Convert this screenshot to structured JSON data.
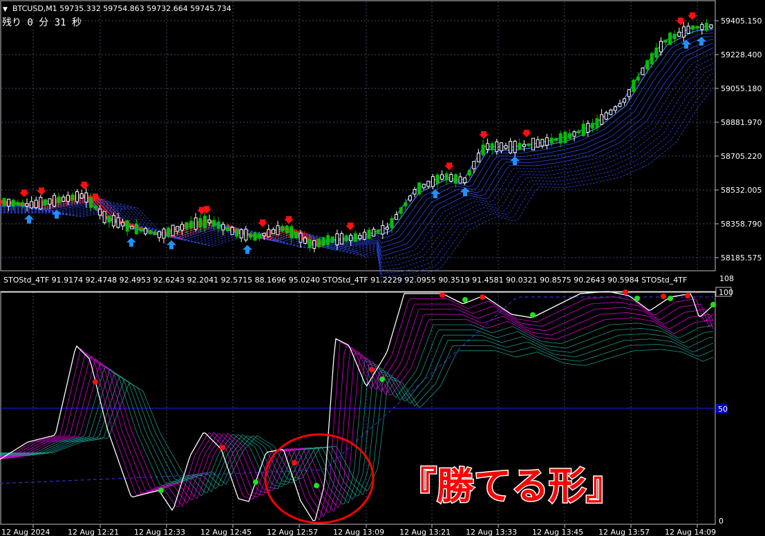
{
  "header": {
    "symbol_arrow": "▼",
    "symbol_line": "BTCUSD,M1  59735.332 59754.863 59732.664 59745.734",
    "remaining": "残り 0 分 31 秒"
  },
  "price_axis": [
    "59405.150",
    "59228.400",
    "59055.180",
    "58881.970",
    "58705.220",
    "58532.005",
    "58358.790",
    "58185.575"
  ],
  "indicator": {
    "label": "STOStd_4TF 91.9174 92.4748 92.4953 92.6243 92.2041 92.5715 88.1696 95.0240  STOStd_4TF 91.2229 92.0955 90.3519 91.4581 90.0321 90.8575 90.2643 90.5984  STOStd_4TF",
    "axis": {
      "top": "108",
      "hundred": "100",
      "fifty": "50",
      "zero": "0"
    }
  },
  "time_axis": [
    "12 Aug 2024",
    "12 Aug 12:21",
    "12 Aug 12:33",
    "12 Aug 12:45",
    "12 Aug 12:57",
    "12 Aug 13:09",
    "12 Aug 13:21",
    "12 Aug 13:33",
    "12 Aug 13:45",
    "12 Aug 13:57",
    "12 Aug 14:09"
  ],
  "annotation": "『勝てる形』",
  "colors": {
    "bull": "#00c000",
    "bear": "#ffffff",
    "grid": "#3a4a6a",
    "ma_red": "#ff2020",
    "ma_blue": "#3060ff",
    "stoch_main": "#ffffff",
    "stoch_magenta": "#ff00ff",
    "stoch_teal": "#20b0a0",
    "circle": "#ff0000"
  }
}
